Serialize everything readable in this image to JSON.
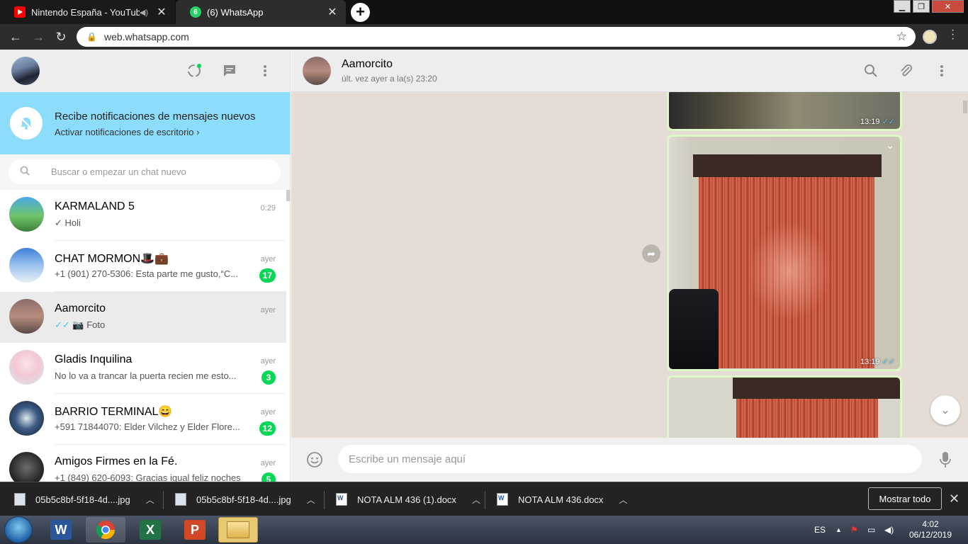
{
  "browser": {
    "tabs": [
      {
        "title": "Nintendo España - YouTube",
        "favicon": "youtube-icon",
        "audio": true,
        "active": false
      },
      {
        "title": "(6) WhatsApp",
        "favicon": "whatsapp-icon",
        "badge": "6",
        "active": true
      }
    ],
    "url": "web.whatsapp.com"
  },
  "sidebar": {
    "notification": {
      "title": "Recibe notificaciones de mensajes nuevos",
      "action": "Activar notificaciones de escritorio ›"
    },
    "search_placeholder": "Buscar o empezar un chat nuevo",
    "chats": [
      {
        "name": "KARMALAND 5",
        "time": "0:29",
        "preview": "✓ Holi",
        "badge": ""
      },
      {
        "name": "CHAT MORMON🎩💼",
        "time": "ayer",
        "preview": "+1 (901) 270-5306: Esta parte me gusto,“C...",
        "badge": "17"
      },
      {
        "name": "Aamorcito",
        "time": "ayer",
        "preview": "Foto",
        "badge": "",
        "selected": true
      },
      {
        "name": "Gladis Inquilina",
        "time": "ayer",
        "preview": "No lo va a trancar la puerta recien me esto...",
        "badge": "3"
      },
      {
        "name": "BARRIO TERMINAL😄",
        "time": "ayer",
        "preview": "+591 71844070: Elder Vilchez y Elder Flore...",
        "badge": "12"
      },
      {
        "name": "Amigos Firmes en la Fé.",
        "time": "ayer",
        "preview": "+1 (849) 620-6093: Gracias igual feliz noches",
        "badge": "5"
      }
    ]
  },
  "conversation": {
    "name": "Aamorcito",
    "status": "últ. vez ayer a la(s) 23:20",
    "messages": [
      {
        "type": "image",
        "time": "13:19"
      },
      {
        "type": "image",
        "time": "13:19"
      },
      {
        "type": "image",
        "time": ""
      }
    ],
    "input_placeholder": "Escribe un mensaje aquí"
  },
  "downloads": {
    "items": [
      {
        "name": "05b5c8bf-5f18-4d....jpg",
        "kind": "jpg"
      },
      {
        "name": "05b5c8bf-5f18-4d....jpg",
        "kind": "jpg"
      },
      {
        "name": "NOTA ALM 436 (1).docx",
        "kind": "docx"
      },
      {
        "name": "NOTA ALM 436.docx",
        "kind": "docx"
      }
    ],
    "show_all": "Mostrar todo"
  },
  "taskbar": {
    "apps": [
      "word-icon",
      "chrome-icon",
      "excel-icon",
      "powerpoint-icon",
      "explorer-icon"
    ],
    "lang": "ES",
    "time": "4:02",
    "date": "06/12/2019"
  },
  "colors": {
    "whatsapp_green": "#06d755",
    "notif_banner": "#8cdcfc",
    "chat_bg": "#e5ddd5",
    "outgoing_bubble": "#dcf8c6",
    "read_tick": "#4fc3f7"
  }
}
